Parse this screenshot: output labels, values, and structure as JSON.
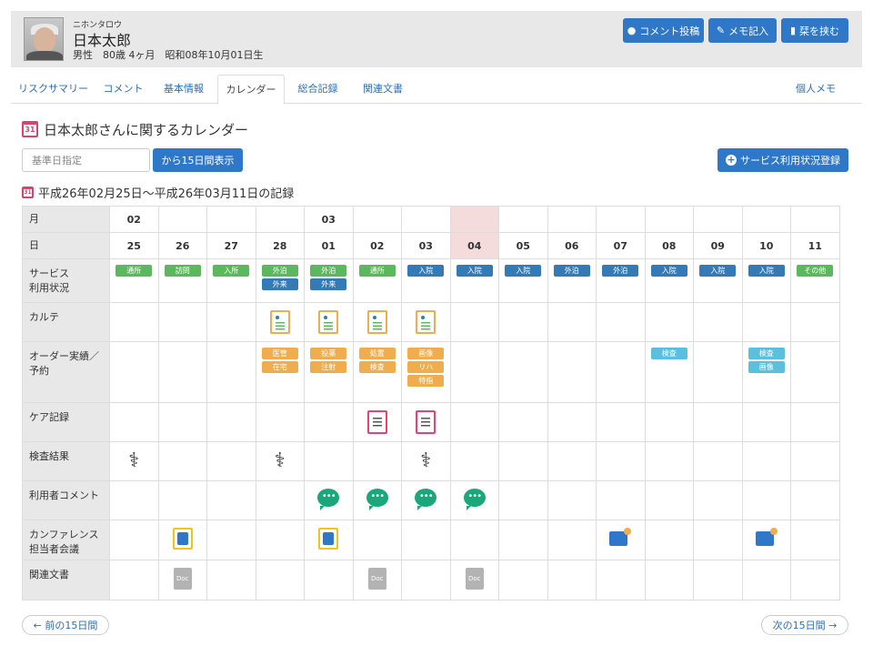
{
  "patient": {
    "kana": "ニホンタロウ",
    "name": "日本太郎",
    "details": "男性　80歳 4ヶ月　昭和08年10月01日生"
  },
  "header_buttons": [
    {
      "label": "コメント投稿",
      "icon": "comment-icon"
    },
    {
      "label": "メモ記入",
      "icon": "edit-icon"
    },
    {
      "label": "栞を挟む",
      "icon": "bookmark-icon"
    }
  ],
  "tabs": [
    {
      "label": "リスクサマリー"
    },
    {
      "label": "コメント"
    },
    {
      "label": "基本情報"
    },
    {
      "label": "カレンダー",
      "active": true
    },
    {
      "label": "総合記録"
    },
    {
      "label": "関連文書"
    },
    {
      "label": "個人メモ"
    }
  ],
  "page_title": "日本太郎さんに関するカレンダー",
  "search": {
    "placeholder": "基準日指定",
    "show_label": "から15日間表示"
  },
  "service_button": "サービス利用状況登録",
  "range_title": "平成26年02月25日～平成26年03月11日の記録",
  "calendar": {
    "row_labels": {
      "month": "月",
      "day": "日",
      "service": "サービス\n利用状況",
      "karte": "カルテ",
      "order": "オーダー実績／\n予約",
      "care": "ケア記録",
      "exam": "検査結果",
      "comment": "利用者コメント",
      "conf": "カンファレンス\n担当者会議",
      "docs": "関連文書"
    },
    "months": [
      "02",
      "",
      "",
      "",
      "03",
      "",
      "",
      "",
      "",
      "",
      "",
      "",
      "",
      "",
      ""
    ],
    "days": [
      "25",
      "26",
      "27",
      "28",
      "01",
      "02",
      "03",
      "04",
      "05",
      "06",
      "07",
      "08",
      "09",
      "10",
      "11"
    ],
    "today_index": 7,
    "service": [
      [
        {
          "t": "通所",
          "c": "green"
        }
      ],
      [
        {
          "t": "訪問",
          "c": "green"
        }
      ],
      [
        {
          "t": "入所",
          "c": "green"
        }
      ],
      [
        {
          "t": "外泊",
          "c": "green"
        },
        {
          "t": "外来",
          "c": "blue"
        }
      ],
      [
        {
          "t": "外泊",
          "c": "green"
        },
        {
          "t": "外来",
          "c": "blue"
        }
      ],
      [
        {
          "t": "通所",
          "c": "green"
        }
      ],
      [
        {
          "t": "入院",
          "c": "blue"
        }
      ],
      [
        {
          "t": "入院",
          "c": "blue"
        }
      ],
      [
        {
          "t": "入院",
          "c": "blue"
        }
      ],
      [
        {
          "t": "外泊",
          "c": "blue"
        }
      ],
      [
        {
          "t": "外泊",
          "c": "blue"
        }
      ],
      [
        {
          "t": "入院",
          "c": "blue"
        }
      ],
      [
        {
          "t": "入院",
          "c": "blue"
        }
      ],
      [
        {
          "t": "入院",
          "c": "blue"
        }
      ],
      [
        {
          "t": "その他",
          "c": "green"
        }
      ]
    ],
    "karte": [
      false,
      false,
      false,
      true,
      true,
      true,
      true,
      false,
      false,
      false,
      false,
      false,
      false,
      false,
      false
    ],
    "orders": [
      [],
      [],
      [],
      [
        {
          "t": "医管",
          "c": "orange"
        },
        {
          "t": "在宅",
          "c": "orange"
        }
      ],
      [
        {
          "t": "投薬",
          "c": "orange"
        },
        {
          "t": "注射",
          "c": "orange"
        }
      ],
      [
        {
          "t": "処置",
          "c": "orange"
        },
        {
          "t": "検査",
          "c": "orange"
        }
      ],
      [
        {
          "t": "画像",
          "c": "orange"
        },
        {
          "t": "リハ",
          "c": "orange"
        },
        {
          "t": "特指",
          "c": "orange"
        }
      ],
      [],
      [],
      [],
      [],
      [
        {
          "t": "検査",
          "c": "cyan"
        }
      ],
      [],
      [
        {
          "t": "検査",
          "c": "cyan"
        },
        {
          "t": "画像",
          "c": "cyan"
        }
      ],
      []
    ],
    "care": [
      false,
      false,
      false,
      false,
      false,
      true,
      true,
      false,
      false,
      false,
      false,
      false,
      false,
      false,
      false
    ],
    "exam": [
      true,
      false,
      false,
      true,
      false,
      false,
      true,
      false,
      false,
      false,
      false,
      false,
      false,
      false,
      false
    ],
    "comments": [
      false,
      false,
      false,
      false,
      true,
      true,
      true,
      true,
      false,
      false,
      false,
      false,
      false,
      false,
      false
    ],
    "conf": [
      "",
      "yellow",
      "",
      "",
      "yellow",
      "",
      "",
      "",
      "",
      "",
      "blue",
      "",
      "",
      "blue",
      ""
    ],
    "docs": [
      false,
      true,
      false,
      false,
      false,
      true,
      false,
      true,
      false,
      false,
      false,
      false,
      false,
      false,
      false
    ],
    "doc_icon_text": "Doc"
  },
  "nav": {
    "prev": "← 前の15日間",
    "next": "次の15日間 →"
  }
}
